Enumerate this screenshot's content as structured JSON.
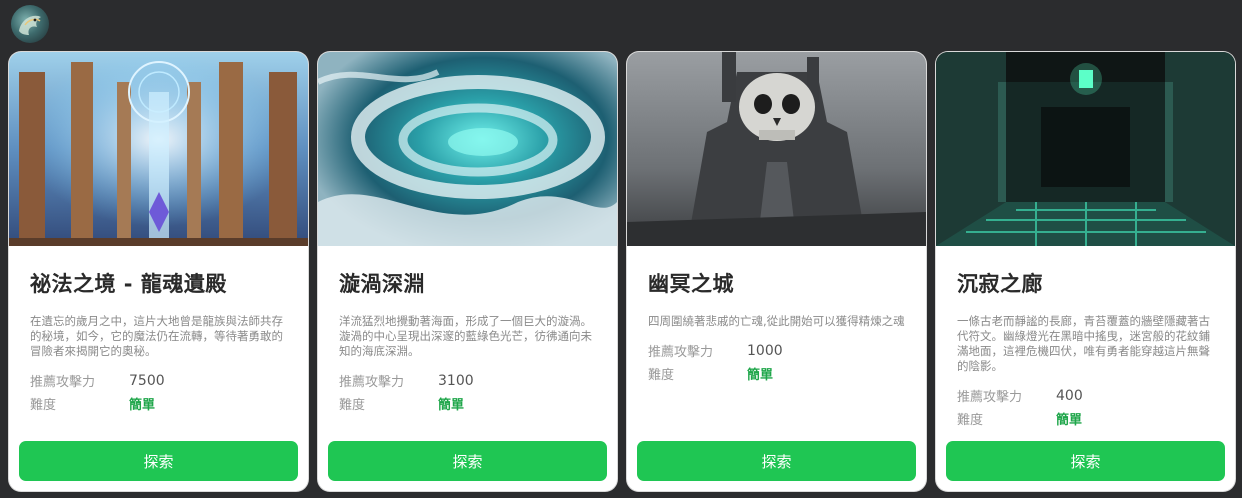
{
  "user": {
    "avatar_icon": "dragon-avatar-icon"
  },
  "labels": {
    "power": "推薦攻擊力",
    "difficulty": "難度"
  },
  "cards": [
    {
      "title": "祕法之境 - 龍魂遺殿",
      "description": "在遺忘的歲月之中，這片大地曾是龍族與法師共存的秘境，如今，它的魔法仍在流轉，等待著勇敢的冒險者來揭開它的奧秘。",
      "power": "7500",
      "difficulty": "簡單",
      "button": "探索"
    },
    {
      "title": "漩渦深淵",
      "description": "洋流猛烈地攪動著海面，形成了一個巨大的漩渦。漩渦的中心呈現出深邃的藍綠色光芒，彷彿通向未知的海底深淵。",
      "power": "3100",
      "difficulty": "簡單",
      "button": "探索"
    },
    {
      "title": "幽冥之城",
      "description": "四周圍繞著悲戚的亡魂,從此開始可以獲得精煉之魂",
      "power": "1000",
      "difficulty": "簡單",
      "button": "探索"
    },
    {
      "title": "沉寂之廊",
      "description": "一條古老而靜謐的長廊，青苔覆蓋的牆壁隱藏著古代符文。幽綠燈光在黑暗中搖曳，迷宮般的花紋鋪滿地面，這裡危機四伏，唯有勇者能穿越這片無聲的陰影。",
      "power": "400",
      "difficulty": "簡單",
      "button": "探索"
    }
  ],
  "colors": {
    "accent": "#1fc653",
    "easy": "#1fa64a",
    "background": "#2b2c2e"
  }
}
